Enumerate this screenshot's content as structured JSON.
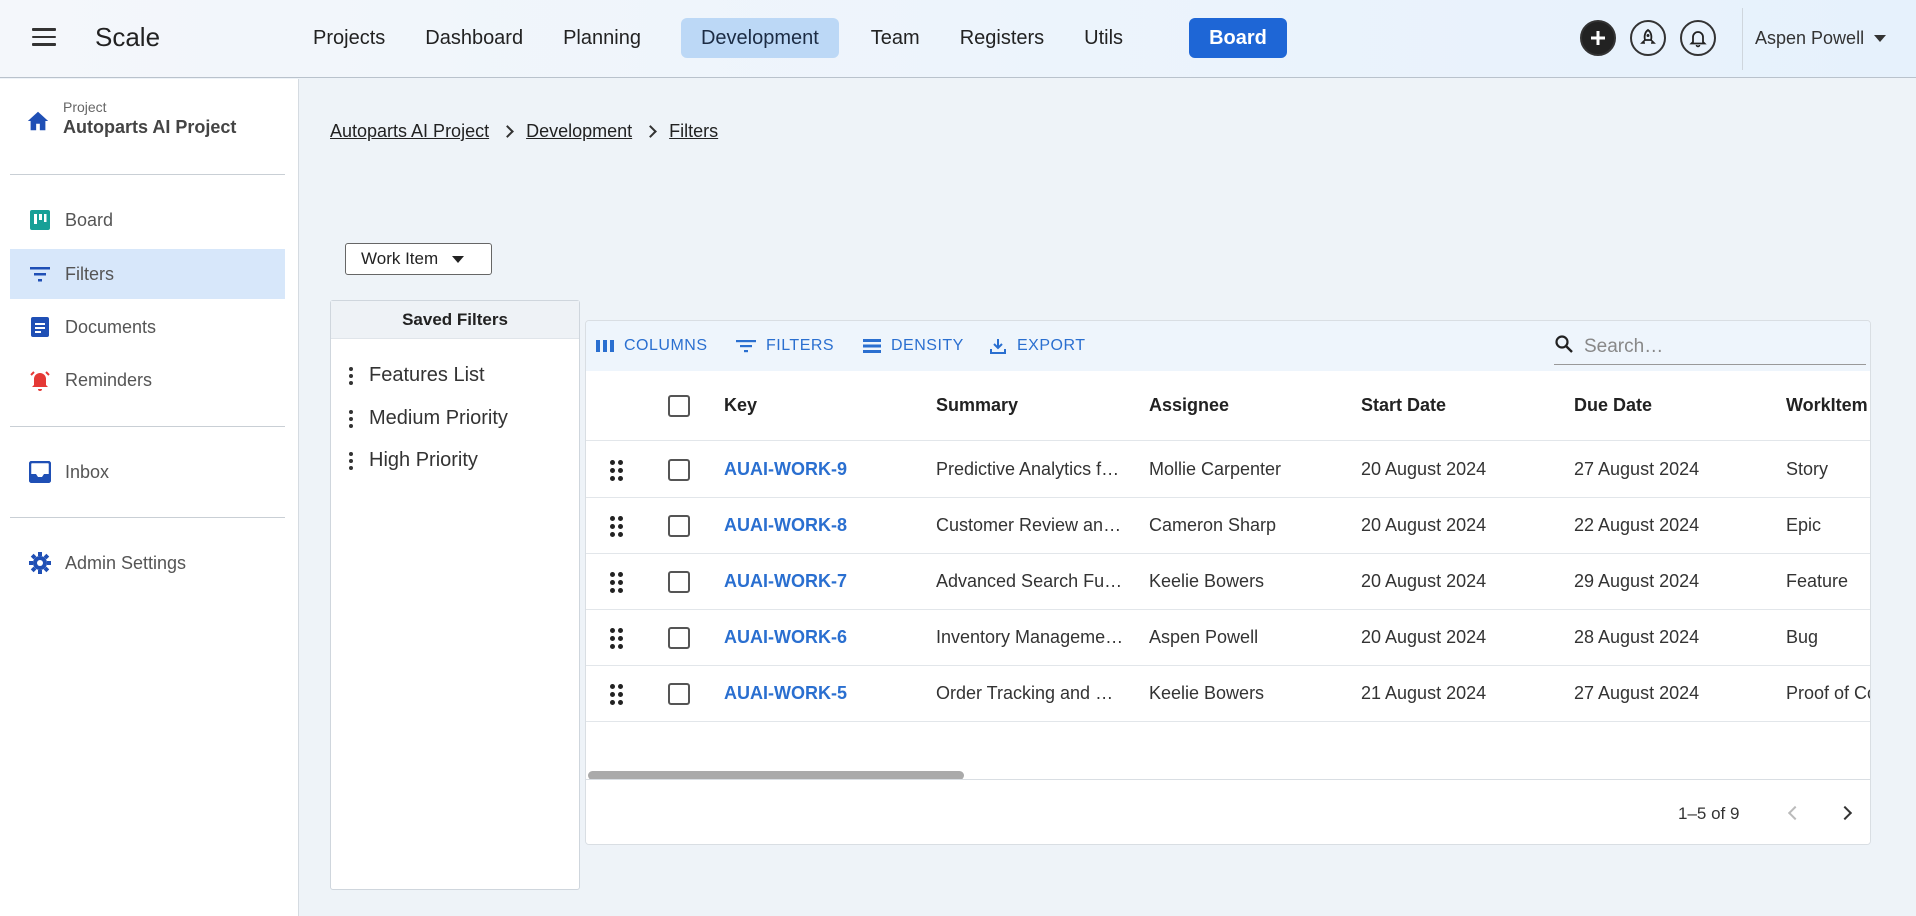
{
  "header": {
    "brand": "Scale",
    "nav": [
      {
        "label": "Projects"
      },
      {
        "label": "Dashboard"
      },
      {
        "label": "Planning"
      },
      {
        "label": "Development",
        "active": true
      },
      {
        "label": "Team"
      },
      {
        "label": "Registers"
      },
      {
        "label": "Utils"
      }
    ],
    "board_label": "Board",
    "user_name": "Aspen Powell",
    "icons": [
      "add-circle-icon",
      "rocket-icon",
      "bell-icon"
    ]
  },
  "sidebar": {
    "project_caption": "Project",
    "project_name": "Autoparts AI Project",
    "items": [
      {
        "label": "Board",
        "icon": "board-icon"
      },
      {
        "label": "Filters",
        "icon": "filter-icon",
        "active": true
      },
      {
        "label": "Documents",
        "icon": "document-icon"
      },
      {
        "label": "Reminders",
        "icon": "alarm-icon"
      },
      {
        "label": "Inbox",
        "icon": "inbox-icon"
      },
      {
        "label": "Admin Settings",
        "icon": "gear-icon"
      }
    ]
  },
  "breadcrumb": [
    "Autoparts AI Project",
    "Development",
    "Filters"
  ],
  "work_item_select": "Work Item",
  "saved_filters": {
    "title": "Saved Filters",
    "items": [
      "Features List",
      "Medium Priority",
      "High Priority"
    ]
  },
  "toolbar": {
    "columns": "COLUMNS",
    "filters": "FILTERS",
    "density": "DENSITY",
    "export": "EXPORT",
    "search_placeholder": "Search…"
  },
  "table": {
    "headers": [
      "Key",
      "Summary",
      "Assignee",
      "Start Date",
      "Due Date",
      "WorkItem"
    ],
    "rows": [
      {
        "key": "AUAI-WORK-9",
        "summary": "Predictive Analytics f…",
        "assignee": "Mollie Carpenter",
        "start": "20 August 2024",
        "due": "27 August 2024",
        "type": "Story"
      },
      {
        "key": "AUAI-WORK-8",
        "summary": "Customer Review an…",
        "assignee": "Cameron Sharp",
        "start": "20 August 2024",
        "due": "22 August 2024",
        "type": "Epic"
      },
      {
        "key": "AUAI-WORK-7",
        "summary": "Advanced Search Fu…",
        "assignee": "Keelie Bowers",
        "start": "20 August 2024",
        "due": "29 August 2024",
        "type": "Feature"
      },
      {
        "key": "AUAI-WORK-6",
        "summary": "Inventory Manageme…",
        "assignee": "Aspen Powell",
        "start": "20 August 2024",
        "due": "28 August 2024",
        "type": "Bug"
      },
      {
        "key": "AUAI-WORK-5",
        "summary": "Order Tracking and …",
        "assignee": "Keelie Bowers",
        "start": "21 August 2024",
        "due": "27 August 2024",
        "type": "Proof of Co"
      }
    ]
  },
  "pagination": "1–5 of 9",
  "colors": {
    "accent": "#1e66d6",
    "link": "#2a6fd0",
    "active_nav": "#bcd8f6",
    "active_side": "#d7e7fa"
  }
}
